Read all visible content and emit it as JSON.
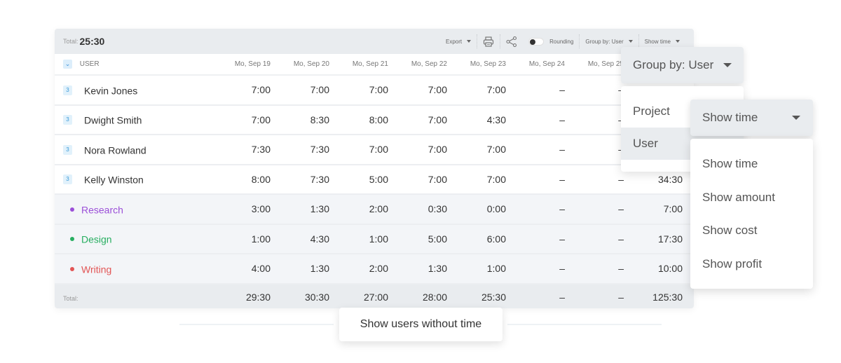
{
  "toolbar": {
    "total_label": "Total:",
    "total_value": "25:30",
    "export_label": "Export",
    "print_icon": "printer-icon",
    "share_icon": "share-icon",
    "rounding_label": "Rounding",
    "rounding_enabled": false,
    "group_by_label": "Group by: User",
    "show_label": "Show time"
  },
  "table": {
    "first_column_header": "USER",
    "columns": [
      "Mo, Sep 19",
      "Mo, Sep 20",
      "Mo, Sep 21",
      "Mo, Sep 22",
      "Mo, Sep 23",
      "Mo, Sep 24",
      "Mo, Sep 25",
      ""
    ],
    "users": [
      {
        "badge": "3",
        "name": "Kevin Jones",
        "values": [
          "7:00",
          "7:00",
          "7:00",
          "7:00",
          "7:00",
          "–",
          "–",
          ""
        ]
      },
      {
        "badge": "3",
        "name": "Dwight Smith",
        "values": [
          "7:00",
          "8:30",
          "8:00",
          "7:00",
          "4:30",
          "–",
          "–",
          ""
        ]
      },
      {
        "badge": "3",
        "name": "Nora Rowland",
        "values": [
          "7:30",
          "7:30",
          "7:00",
          "7:00",
          "7:00",
          "–",
          "–",
          ""
        ]
      },
      {
        "badge": "3",
        "name": "Kelly Winston",
        "values": [
          "8:00",
          "7:30",
          "5:00",
          "7:00",
          "7:00",
          "–",
          "–",
          "34:30"
        ]
      }
    ],
    "projects": [
      {
        "name": "Research",
        "color": "#9b4fd8",
        "values": [
          "3:00",
          "1:30",
          "2:00",
          "0:30",
          "0:00",
          "–",
          "–",
          "7:00"
        ]
      },
      {
        "name": "Design",
        "color": "#27ae60",
        "values": [
          "1:00",
          "4:30",
          "1:00",
          "5:00",
          "6:00",
          "–",
          "–",
          "17:30"
        ]
      },
      {
        "name": "Writing",
        "color": "#e25555",
        "values": [
          "4:00",
          "1:30",
          "2:00",
          "1:30",
          "1:00",
          "–",
          "–",
          "10:00"
        ]
      }
    ],
    "total_row": {
      "label": "Total:",
      "values": [
        "29:30",
        "30:30",
        "27:00",
        "28:00",
        "25:30",
        "–",
        "–",
        "125:30"
      ]
    }
  },
  "group_by_dropdown": {
    "label": "Group by: User",
    "options": [
      "Project",
      "User"
    ],
    "selected": "User"
  },
  "show_dropdown": {
    "label": "Show time",
    "options": [
      "Show time",
      "Show amount",
      "Show cost",
      "Show profit"
    ]
  },
  "footer": {
    "show_users_button": "Show users without time"
  }
}
